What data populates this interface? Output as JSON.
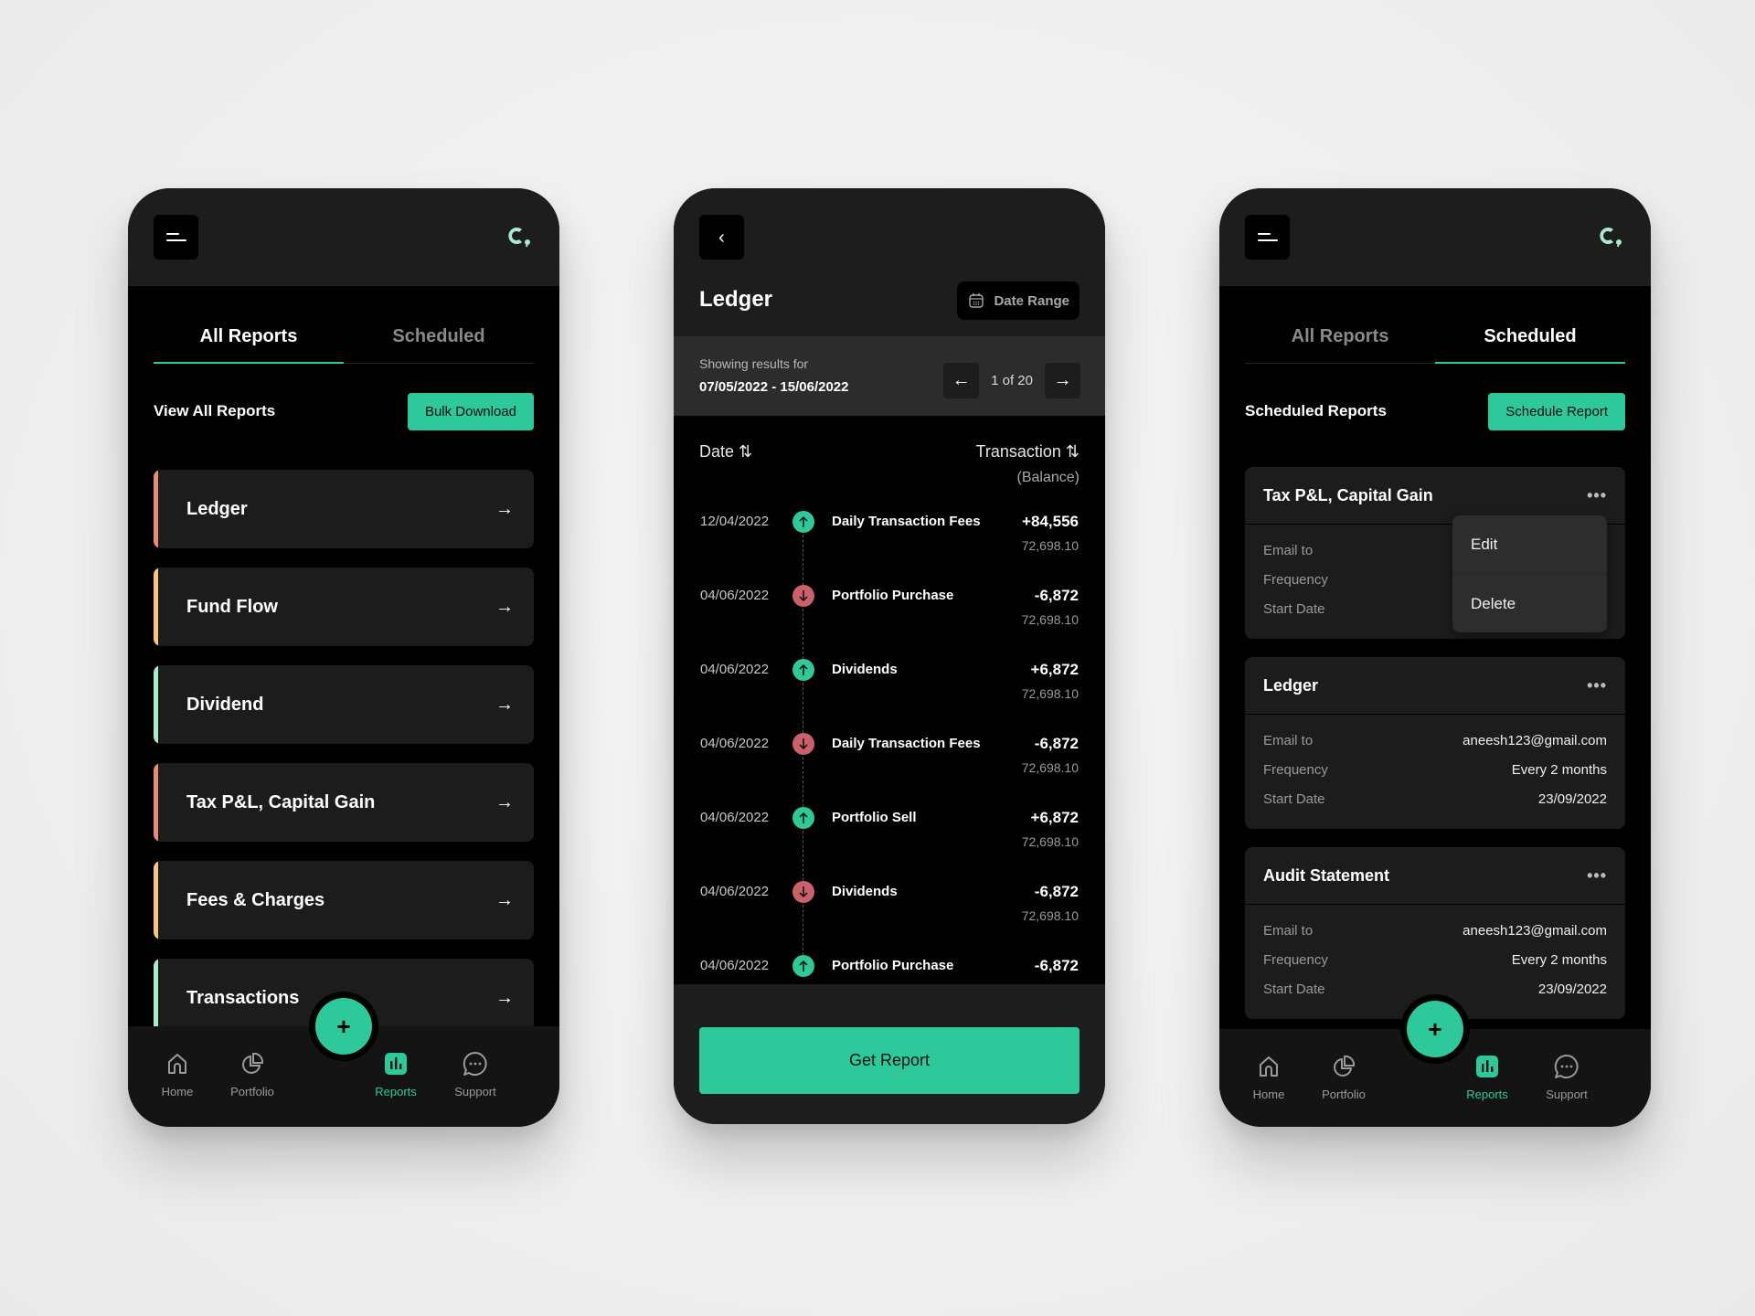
{
  "colors": {
    "accent": "#2ec99a",
    "negative": "#c9606c",
    "accent_coral": "#e98d74",
    "accent_amber": "#f6c877",
    "accent_mint": "#a8ecc9",
    "logo": "#a8ecc9"
  },
  "screen_reports": {
    "header": {
      "menu_icon": "menu-icon",
      "logo_icon": "brand-logo-icon"
    },
    "tabs": [
      {
        "label": "All Reports",
        "active": true
      },
      {
        "label": "Scheduled",
        "active": false
      }
    ],
    "section_title": "View All Reports",
    "bulk_download_label": "Bulk Download",
    "reports": [
      {
        "label": "Ledger",
        "accent": "#e98d74"
      },
      {
        "label": "Fund Flow",
        "accent": "#f6c877"
      },
      {
        "label": "Dividend",
        "accent": "#a8ecc9"
      },
      {
        "label": "Tax P&L, Capital Gain",
        "accent": "#e98d74"
      },
      {
        "label": "Fees & Charges",
        "accent": "#f6c877"
      },
      {
        "label": "Transactions",
        "accent": "#a8ecc9"
      }
    ],
    "arrow_glyph": "→"
  },
  "bottom_nav": {
    "fab_label": "+",
    "items": [
      {
        "label": "Home",
        "icon": "home-icon",
        "active": false
      },
      {
        "label": "Portfolio",
        "icon": "pie-chart-icon",
        "active": false
      },
      {
        "label": "Reports",
        "icon": "bar-chart-icon",
        "active": true
      },
      {
        "label": "Support",
        "icon": "chat-bubble-icon",
        "active": false
      }
    ]
  },
  "screen_ledger": {
    "back_glyph": "‹",
    "title": "Ledger",
    "date_range_label": "Date Range",
    "showing_results_label": "Showing results for",
    "date_span": "07/05/2022 - 15/06/2022",
    "pager": {
      "prev": "←",
      "next": "→",
      "text": "1 of 20",
      "current": 1,
      "total": 20
    },
    "columns": {
      "date": "Date ⇅",
      "transaction": "Transaction ⇅",
      "balance": "(Balance)"
    },
    "transactions": [
      {
        "date": "12/04/2022",
        "direction": "up",
        "name": "Daily Transaction Fees",
        "amount": "+84,556",
        "balance": "72,698.10"
      },
      {
        "date": "04/06/2022",
        "direction": "down",
        "name": "Portfolio Purchase",
        "amount": "-6,872",
        "balance": "72,698.10"
      },
      {
        "date": "04/06/2022",
        "direction": "up",
        "name": "Dividends",
        "amount": "+6,872",
        "balance": "72,698.10"
      },
      {
        "date": "04/06/2022",
        "direction": "down",
        "name": "Daily Transaction Fees",
        "amount": "-6,872",
        "balance": "72,698.10"
      },
      {
        "date": "04/06/2022",
        "direction": "up",
        "name": "Portfolio Sell",
        "amount": "+6,872",
        "balance": "72,698.10"
      },
      {
        "date": "04/06/2022",
        "direction": "down",
        "name": "Dividends",
        "amount": "-6,872",
        "balance": "72,698.10"
      },
      {
        "date": "04/06/2022",
        "direction": "up",
        "name": "Portfolio Purchase",
        "amount": "-6,872",
        "balance": ""
      }
    ],
    "get_report_label": "Get Report"
  },
  "screen_scheduled": {
    "tabs": [
      {
        "label": "All Reports",
        "active": false
      },
      {
        "label": "Scheduled",
        "active": true
      }
    ],
    "section_title": "Scheduled Reports",
    "schedule_button_label": "Schedule Report",
    "more_glyph": "•••",
    "field_labels": {
      "email": "Email to",
      "frequency": "Frequency",
      "start_date": "Start Date"
    },
    "cards": [
      {
        "title": "Tax P&L, Capital Gain",
        "email": "",
        "frequency": "",
        "start_date": "",
        "menu_open": true
      },
      {
        "title": "Ledger",
        "email": "aneesh123@gmail.com",
        "frequency": "Every 2 months",
        "start_date": "23/09/2022",
        "menu_open": false
      },
      {
        "title": "Audit Statement",
        "email": "aneesh123@gmail.com",
        "frequency": "Every 2 months",
        "start_date": "23/09/2022",
        "menu_open": false
      }
    ],
    "dropdown": [
      {
        "label": "Edit"
      },
      {
        "label": "Delete"
      }
    ]
  }
}
